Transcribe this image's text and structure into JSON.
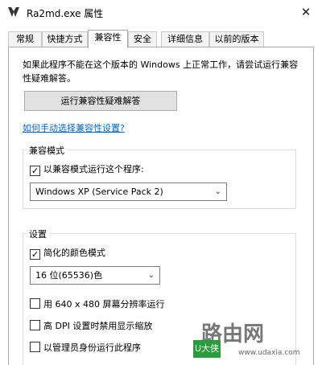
{
  "window": {
    "title": "Ra2md.exe 属性",
    "close_glyph": "✕"
  },
  "tabs": [
    {
      "label": "常规"
    },
    {
      "label": "快捷方式"
    },
    {
      "label": "兼容性"
    },
    {
      "label": "安全"
    },
    {
      "label": "详细信息"
    },
    {
      "label": "以前的版本"
    }
  ],
  "active_tab": "兼容性",
  "compat": {
    "intro": "如果此程序不能在这个版本的 Windows 上正常工作，请尝试运行兼容性疑难解答。",
    "troubleshoot_button": "运行兼容性疑难解答",
    "manual_link": "如何手动选择兼容性设置?",
    "mode_group": {
      "label": "兼容模式",
      "checkbox_label": "以兼容模式运行这个程序:",
      "checked": true,
      "os_selected": "Windows XP (Service Pack 2)"
    },
    "settings_group": {
      "label": "设置",
      "reduced_color": {
        "label": "简化的颜色模式",
        "checked": true
      },
      "color_selected": "16 位(65536)色",
      "res_640": {
        "label": "用 640 x 480 屏幕分辨率运行",
        "checked": false
      },
      "high_dpi": {
        "label": "高 DPI 设置时禁用显示缩放",
        "checked": false
      },
      "run_admin": {
        "label": "以管理员身份运行此程序",
        "checked": false
      }
    },
    "check_glyph": "✓",
    "arrow_glyph": "⌄"
  },
  "watermark": {
    "logo": "U大侠",
    "brand": "路由网",
    "url": "www.udaxia.com"
  },
  "colors": {
    "link": "#0066cc",
    "button_bg": "#e1e1e1",
    "watermark_green": "#2a9d3b"
  }
}
